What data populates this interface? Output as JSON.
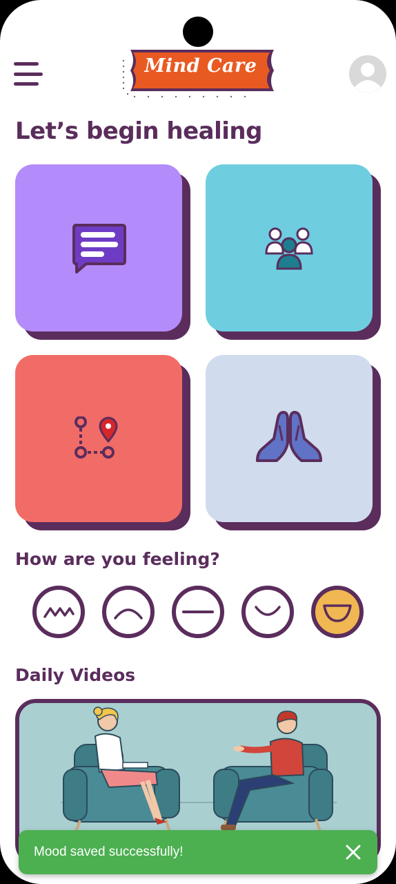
{
  "header": {
    "logo_text": "Mind Care"
  },
  "colors": {
    "brand_purple": "#5a2d5c",
    "logo_orange": "#e95a22",
    "tile_chat": "#b48bfb",
    "tile_group": "#6fcde0",
    "tile_journey": "#f26c67",
    "tile_pray": "#d0dbee",
    "mood_selected": "#f0b752",
    "toast_green": "#4caf50"
  },
  "main": {
    "title": "Let’s begin healing",
    "tiles": [
      {
        "icon": "chat-icon"
      },
      {
        "icon": "group-icon"
      },
      {
        "icon": "route-icon"
      },
      {
        "icon": "praying-hands-icon"
      }
    ]
  },
  "mood": {
    "title": "How are you feeling?",
    "options": [
      {
        "icon": "zigzag-mood-icon"
      },
      {
        "icon": "sad-mood-icon"
      },
      {
        "icon": "neutral-mood-icon"
      },
      {
        "icon": "smile-mood-icon"
      },
      {
        "icon": "happy-mood-icon",
        "selected": true
      }
    ]
  },
  "videos": {
    "title": "Daily Videos"
  },
  "toast": {
    "message": "Mood saved successfully!"
  }
}
